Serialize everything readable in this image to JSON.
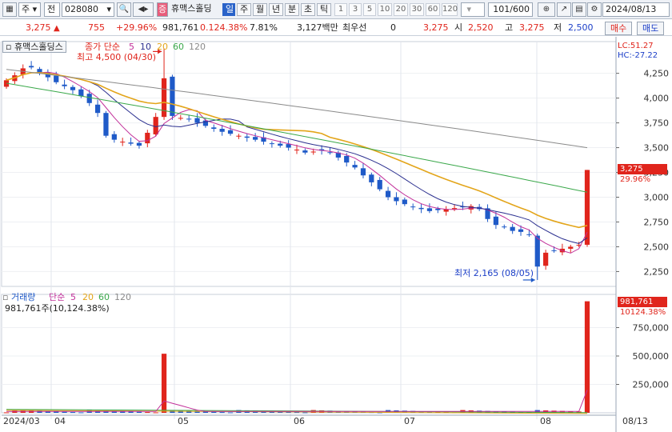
{
  "toolbar": {
    "type_label": "주",
    "market_label": "전",
    "code": "028080",
    "badge": "증",
    "stock_name": "휴맥스홀딩",
    "periods": [
      "일",
      "주",
      "월",
      "년",
      "분",
      "초",
      "틱"
    ],
    "active_period": "일",
    "intervals": [
      "1",
      "3",
      "5",
      "10",
      "20",
      "30",
      "60",
      "120"
    ],
    "count": "101/600",
    "date": "2024/08/13"
  },
  "quote": {
    "price": "3,275",
    "change": "755",
    "change_pct": "+29.96%",
    "volume": "981,761",
    "volume_ratio": "0.124.38%",
    "turnover": "7.81%",
    "amount": "3,127백만",
    "best_label": "최우선",
    "best_value": "0",
    "ask": "3,275",
    "open_label": "시",
    "open": "2,520",
    "high_label": "고",
    "high": "3,275",
    "low_label": "저",
    "low": "2,500",
    "buy_label": "매수",
    "sell_label": "매도"
  },
  "price_panel": {
    "title": "휴맥스홀딩스",
    "ma_label": "종가 단순",
    "ma_periods": [
      "5",
      "10",
      "20",
      "60",
      "120"
    ],
    "high_note": "최고 4,500 (04/30)",
    "low_note": "최저 2,165 (08/05)",
    "lc": "LC:51.27",
    "hc": "HC:-27.22",
    "last_price": "3,275",
    "last_pct": "29.96%"
  },
  "volume_panel": {
    "title": "거래량",
    "ma_label": "단순",
    "ma_periods": [
      "5",
      "20",
      "60",
      "120"
    ],
    "current": "981,761주(10,124.38%)",
    "last_volume": "981,761",
    "last_pct": "10124.38%"
  },
  "x_axis": {
    "labels": [
      "2024/03",
      "04",
      "05",
      "06",
      "07",
      "08",
      "08/13"
    ]
  },
  "colors": {
    "up": "#e0251c",
    "down": "#1f5ac8",
    "ma5": "#c2309a",
    "ma10": "#2b2f8f",
    "ma20": "#e3a51a",
    "ma60": "#3aa84a",
    "ma120": "#8a8a8a"
  },
  "chart_data": {
    "type": "candlestick",
    "price_axis": {
      "ticks": [
        2250,
        2500,
        2750,
        3000,
        3250,
        3500,
        3750,
        4000,
        4250
      ],
      "ylim": [
        2100,
        4570
      ]
    },
    "volume_axis": {
      "ticks": [
        250000,
        500000,
        750000
      ],
      "ylim": [
        0,
        1000000
      ]
    },
    "x_months": [
      "2024/03",
      "04",
      "05",
      "06",
      "07",
      "08",
      "08/13"
    ],
    "close_path": [
      4180,
      4230,
      4300,
      4310,
      4260,
      4210,
      4160,
      4120,
      4080,
      4020,
      3950,
      3850,
      3620,
      3580,
      3560,
      3540,
      3520,
      3650,
      3810,
      4200,
      3820,
      3800,
      3790,
      3750,
      3720,
      3690,
      3660,
      3640,
      3620,
      3600,
      3580,
      3560,
      3540,
      3520,
      3500,
      3480,
      3450,
      3460,
      3470,
      3450,
      3400,
      3350,
      3300,
      3220,
      3150,
      3080,
      3000,
      2960,
      2930,
      2900,
      2880,
      2860,
      2870,
      2880,
      2890,
      2900,
      2910,
      2880,
      2780,
      2720,
      2700,
      2660,
      2650,
      2620,
      2300,
      2440,
      2460,
      2480,
      2500,
      2520,
      3275
    ],
    "last_bar": {
      "open": 2520,
      "high": 3275,
      "low": 2500,
      "close": 3275,
      "volume": 981761
    },
    "high_point": {
      "value": 4500,
      "date": "04/30"
    },
    "low_point": {
      "value": 2165,
      "date": "08/05"
    },
    "ma_end": {
      "ma5": 2540,
      "ma10": 2520,
      "ma20": 2690,
      "ma60": 3050,
      "ma120": 3500
    },
    "volume_spike": {
      "date": "04/30",
      "value": 520000
    }
  }
}
